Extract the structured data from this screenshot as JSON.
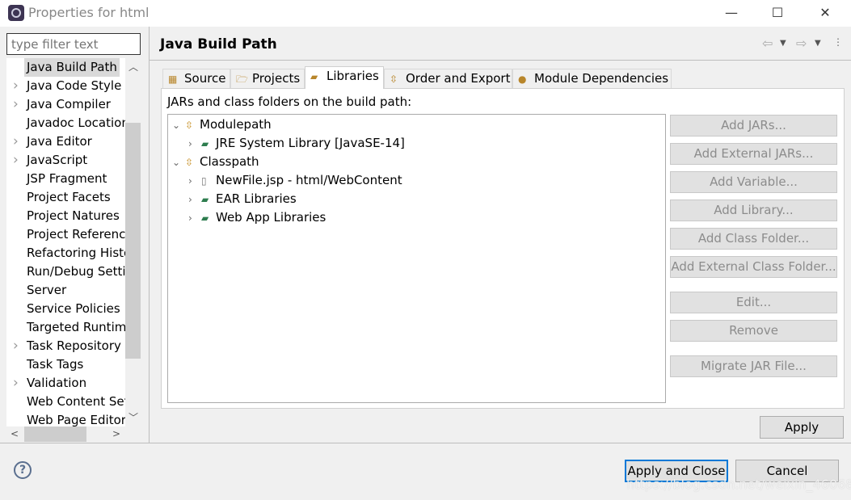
{
  "window": {
    "title": "Properties for html",
    "minimize": "—",
    "maximize": "☐",
    "close": "✕"
  },
  "filter": {
    "placeholder": "type filter text"
  },
  "sidebar": {
    "items": [
      {
        "label": "Java Build Path",
        "expandable": false,
        "selected": true
      },
      {
        "label": "Java Code Style",
        "expandable": true
      },
      {
        "label": "Java Compiler",
        "expandable": true
      },
      {
        "label": "Javadoc Location",
        "expandable": false
      },
      {
        "label": "Java Editor",
        "expandable": true
      },
      {
        "label": "JavaScript",
        "expandable": true
      },
      {
        "label": "JSP Fragment",
        "expandable": false
      },
      {
        "label": "Project Facets",
        "expandable": false
      },
      {
        "label": "Project Natures",
        "expandable": false
      },
      {
        "label": "Project References",
        "expandable": false
      },
      {
        "label": "Refactoring History",
        "expandable": false
      },
      {
        "label": "Run/Debug Settings",
        "expandable": false
      },
      {
        "label": "Server",
        "expandable": false
      },
      {
        "label": "Service Policies",
        "expandable": false
      },
      {
        "label": "Targeted Runtimes",
        "expandable": false
      },
      {
        "label": "Task Repository",
        "expandable": true
      },
      {
        "label": "Task Tags",
        "expandable": false
      },
      {
        "label": "Validation",
        "expandable": true
      },
      {
        "label": "Web Content Settings",
        "expandable": false
      },
      {
        "label": "Web Page Editor",
        "expandable": false
      }
    ]
  },
  "header": {
    "title": "Java Build Path"
  },
  "tabs": [
    {
      "label": "Source",
      "icon": "source-folder-icon"
    },
    {
      "label": "Projects",
      "icon": "folder-icon"
    },
    {
      "label": "Libraries",
      "icon": "library-icon",
      "active": true
    },
    {
      "label": "Order and Export",
      "icon": "order-icon"
    },
    {
      "label": "Module Dependencies",
      "icon": "module-icon"
    }
  ],
  "libraries": {
    "description": "JARs and class folders on the build path:",
    "tree": [
      {
        "label": "Modulepath",
        "level": 0,
        "expanded": true
      },
      {
        "label": "JRE System Library [JavaSE-14]",
        "level": 1
      },
      {
        "label": "Classpath",
        "level": 0,
        "expanded": true
      },
      {
        "label": "NewFile.jsp - html/WebContent",
        "level": 1
      },
      {
        "label": "EAR Libraries",
        "level": 1
      },
      {
        "label": "Web App Libraries",
        "level": 1
      }
    ],
    "buttons": [
      "Add JARs...",
      "Add External JARs...",
      "Add Variable...",
      "Add Library...",
      "Add Class Folder...",
      "Add External Class Folder...",
      "Edit...",
      "Remove",
      "Migrate JAR File..."
    ]
  },
  "footer": {
    "apply": "Apply",
    "apply_close": "Apply and Close",
    "cancel": "Cancel",
    "help": "?",
    "watermark": "https://blog.csdn.net/weixin_46068252"
  }
}
